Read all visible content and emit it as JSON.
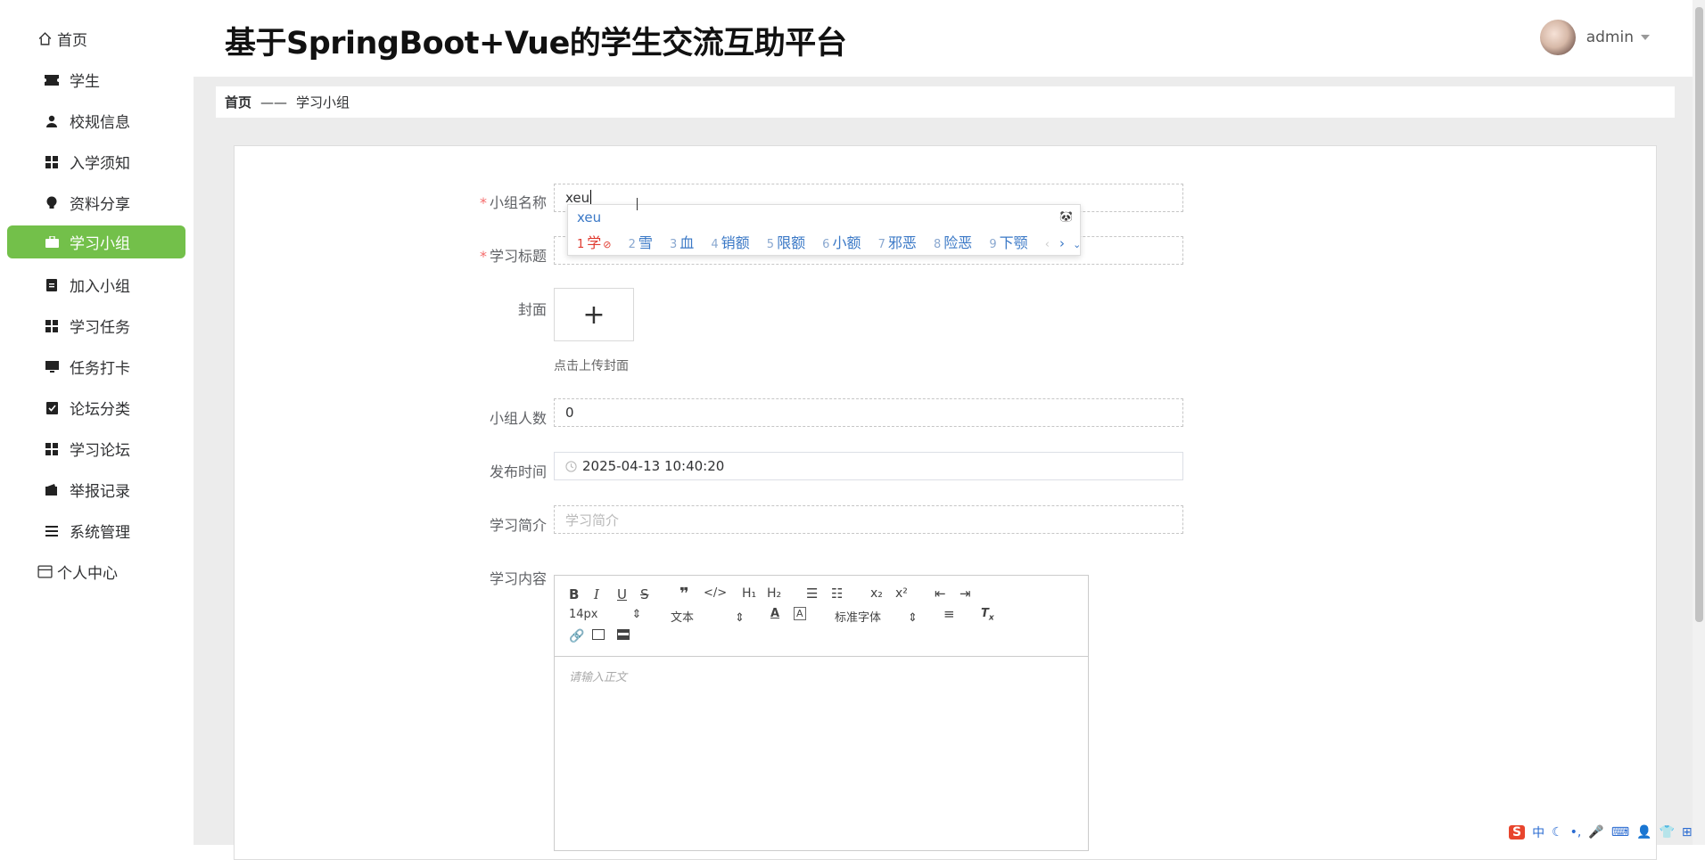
{
  "header": {
    "title": "基于SpringBoot+Vue的学生交流互助平台",
    "user": "admin"
  },
  "sidebar": {
    "items": [
      {
        "label": "首页",
        "icon": "home-icon",
        "type": "top"
      },
      {
        "label": "学生",
        "icon": "ticket-icon",
        "type": "sub"
      },
      {
        "label": "校规信息",
        "icon": "user-icon",
        "type": "sub"
      },
      {
        "label": "入学须知",
        "icon": "grid-icon",
        "type": "sub"
      },
      {
        "label": "资料分享",
        "icon": "bulb-icon",
        "type": "sub"
      },
      {
        "label": "学习小组",
        "icon": "briefcase-icon",
        "type": "sub",
        "active": true
      },
      {
        "label": "加入小组",
        "icon": "clipboard-icon",
        "type": "sub"
      },
      {
        "label": "学习任务",
        "icon": "grid-icon",
        "type": "sub"
      },
      {
        "label": "任务打卡",
        "icon": "monitor-icon",
        "type": "sub"
      },
      {
        "label": "论坛分类",
        "icon": "checklist-icon",
        "type": "sub"
      },
      {
        "label": "学习论坛",
        "icon": "grid-icon",
        "type": "sub"
      },
      {
        "label": "举报记录",
        "icon": "wallet-icon",
        "type": "sub"
      },
      {
        "label": "系统管理",
        "icon": "list-icon",
        "type": "sub"
      },
      {
        "label": "个人中心",
        "icon": "card-icon",
        "type": "top"
      }
    ]
  },
  "breadcrumb": {
    "home": "首页",
    "sep": "——",
    "current": "学习小组"
  },
  "form": {
    "name_label": "小组名称",
    "name_value": "xeu",
    "title_label": "学习标题",
    "cover_label": "封面",
    "cover_hint": "点击上传封面",
    "cover_plus": "+",
    "count_label": "小组人数",
    "count_value": "0",
    "time_label": "发布时间",
    "time_value": "2025-04-13 10:40:20",
    "intro_label": "学习简介",
    "intro_placeholder": "学习简介",
    "content_label": "学习内容"
  },
  "editor": {
    "font_size": "14px",
    "header_select": "文本",
    "font_select": "标准字体",
    "placeholder": "请输入正文"
  },
  "ime": {
    "composition": "xeu",
    "candidates": [
      {
        "n": "1",
        "t": "学"
      },
      {
        "n": "2",
        "t": "雪"
      },
      {
        "n": "3",
        "t": "血"
      },
      {
        "n": "4",
        "t": "销额"
      },
      {
        "n": "5",
        "t": "限额"
      },
      {
        "n": "6",
        "t": "小额"
      },
      {
        "n": "7",
        "t": "邪恶"
      },
      {
        "n": "8",
        "t": "险恶"
      },
      {
        "n": "9",
        "t": "下颚"
      }
    ]
  },
  "tray": {
    "ime_mode": "中"
  },
  "colors": {
    "accent": "#73c04a",
    "required": "#f56c6c",
    "ime_blue": "#3a78c6"
  }
}
